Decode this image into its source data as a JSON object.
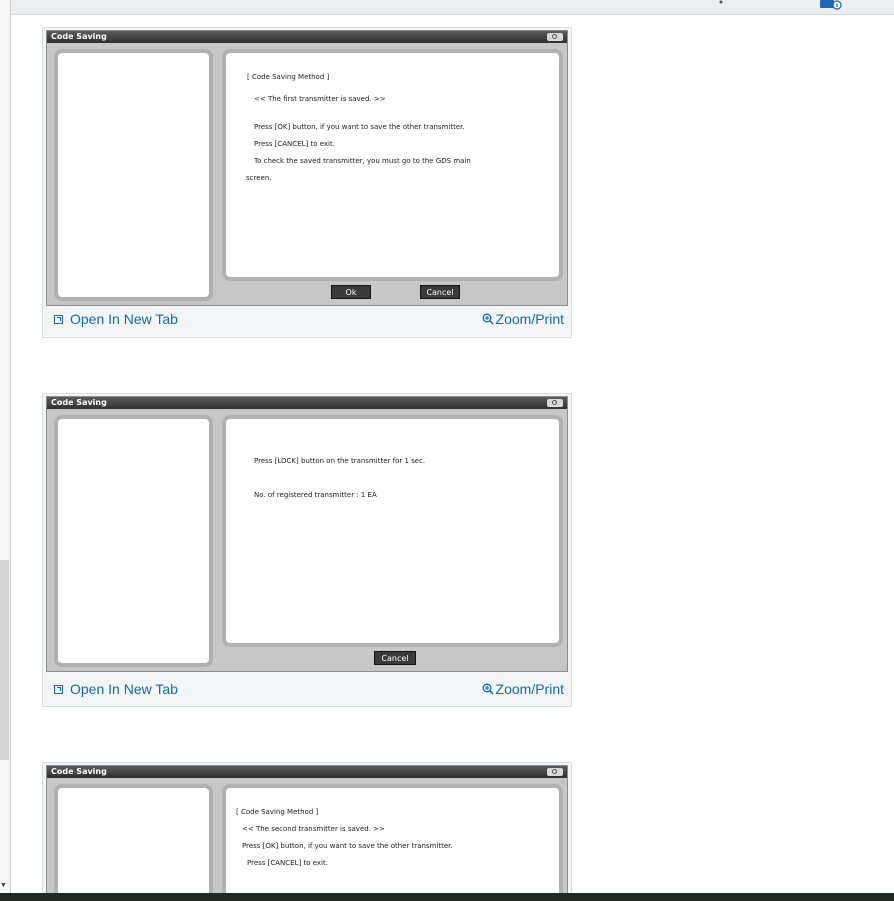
{
  "figures": [
    {
      "window_title": "Code Saving",
      "lines": [
        "[ Code Saving Method ]",
        "<< The first transmitter is saved. >>",
        "Press [OK] button, if you want to save the other transmitter.",
        "Press [CANCEL] to exit.",
        "To check the saved transmitter, you must go to the GDS main",
        "screen."
      ],
      "buttons": [
        "Ok",
        "Cancel"
      ],
      "open_tab_label": "Open In New Tab",
      "zoom_label": "Zoom/Print"
    },
    {
      "window_title": "Code Saving",
      "lines": [
        "Press [LOCK] button on the transmitter for 1 sec.",
        "No. of registered transmitter : 1 EA"
      ],
      "buttons": [
        "Cancel"
      ],
      "open_tab_label": "Open In New Tab",
      "zoom_label": "Zoom/Print"
    },
    {
      "window_title": "Code Saving",
      "lines": [
        "[ Code Saving Method ]",
        "<< The second transmitter is saved. >>",
        "Press [OK] button, if you want to save the other transmitter.",
        "Press [CANCEL] to exit."
      ]
    }
  ],
  "colors": {
    "link": "#0b6bbf",
    "titlebar": "#3a3a3a",
    "panel_border": "#b1b1b1"
  }
}
